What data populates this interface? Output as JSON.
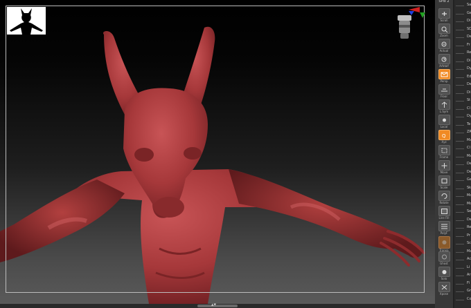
{
  "toolbar": {
    "top_label": "SPix 2",
    "items": [
      {
        "label": "Scroll",
        "state": "normal"
      },
      {
        "label": "Zoom",
        "state": "normal"
      },
      {
        "label": "Actual",
        "state": "normal"
      },
      {
        "label": "AAHalf",
        "state": "normal"
      },
      {
        "label": "Persp",
        "state": "on"
      },
      {
        "label": "Floor",
        "state": "normal"
      },
      {
        "label": "L.Sym",
        "state": "normal"
      },
      {
        "label": "Local",
        "state": "normal"
      },
      {
        "label": "Xyz",
        "state": "on"
      },
      {
        "label": "Frame",
        "state": "normal"
      },
      {
        "label": "Move",
        "state": "normal"
      },
      {
        "label": "Scale",
        "state": "normal"
      },
      {
        "label": "Rotate",
        "state": "normal"
      },
      {
        "label": "Line Fill",
        "state": "normal"
      },
      {
        "label": "PolyF",
        "state": "normal"
      },
      {
        "label": "Transp",
        "state": "normal"
      },
      {
        "label": "Ghost",
        "state": "normal"
      },
      {
        "label": "Solo",
        "state": "normal"
      },
      {
        "label": "Xpose",
        "state": "normal"
      }
    ]
  },
  "tray": {
    "rows": [
      "Sa",
      "Ge",
      "Di",
      "SD",
      "De",
      "Fr",
      "Re",
      "Di",
      "Dy",
      "Ed",
      "De",
      "Di",
      "St",
      "Cl",
      "Dy",
      "Te",
      "ZR",
      "Ma",
      "Cl",
      "Ma",
      "De",
      "De",
      "Ge",
      "Sk",
      "Mo",
      "Mo",
      "Se",
      "De",
      "Re",
      "Pr",
      "Sc",
      "Ma",
      "Ac",
      "Li",
      "Ar",
      "Fi",
      "Gr",
      "Co"
    ]
  },
  "colors": {
    "accent_on": "#f08a24",
    "model_skin": "#a6383a",
    "panel_bg": "#383838"
  }
}
